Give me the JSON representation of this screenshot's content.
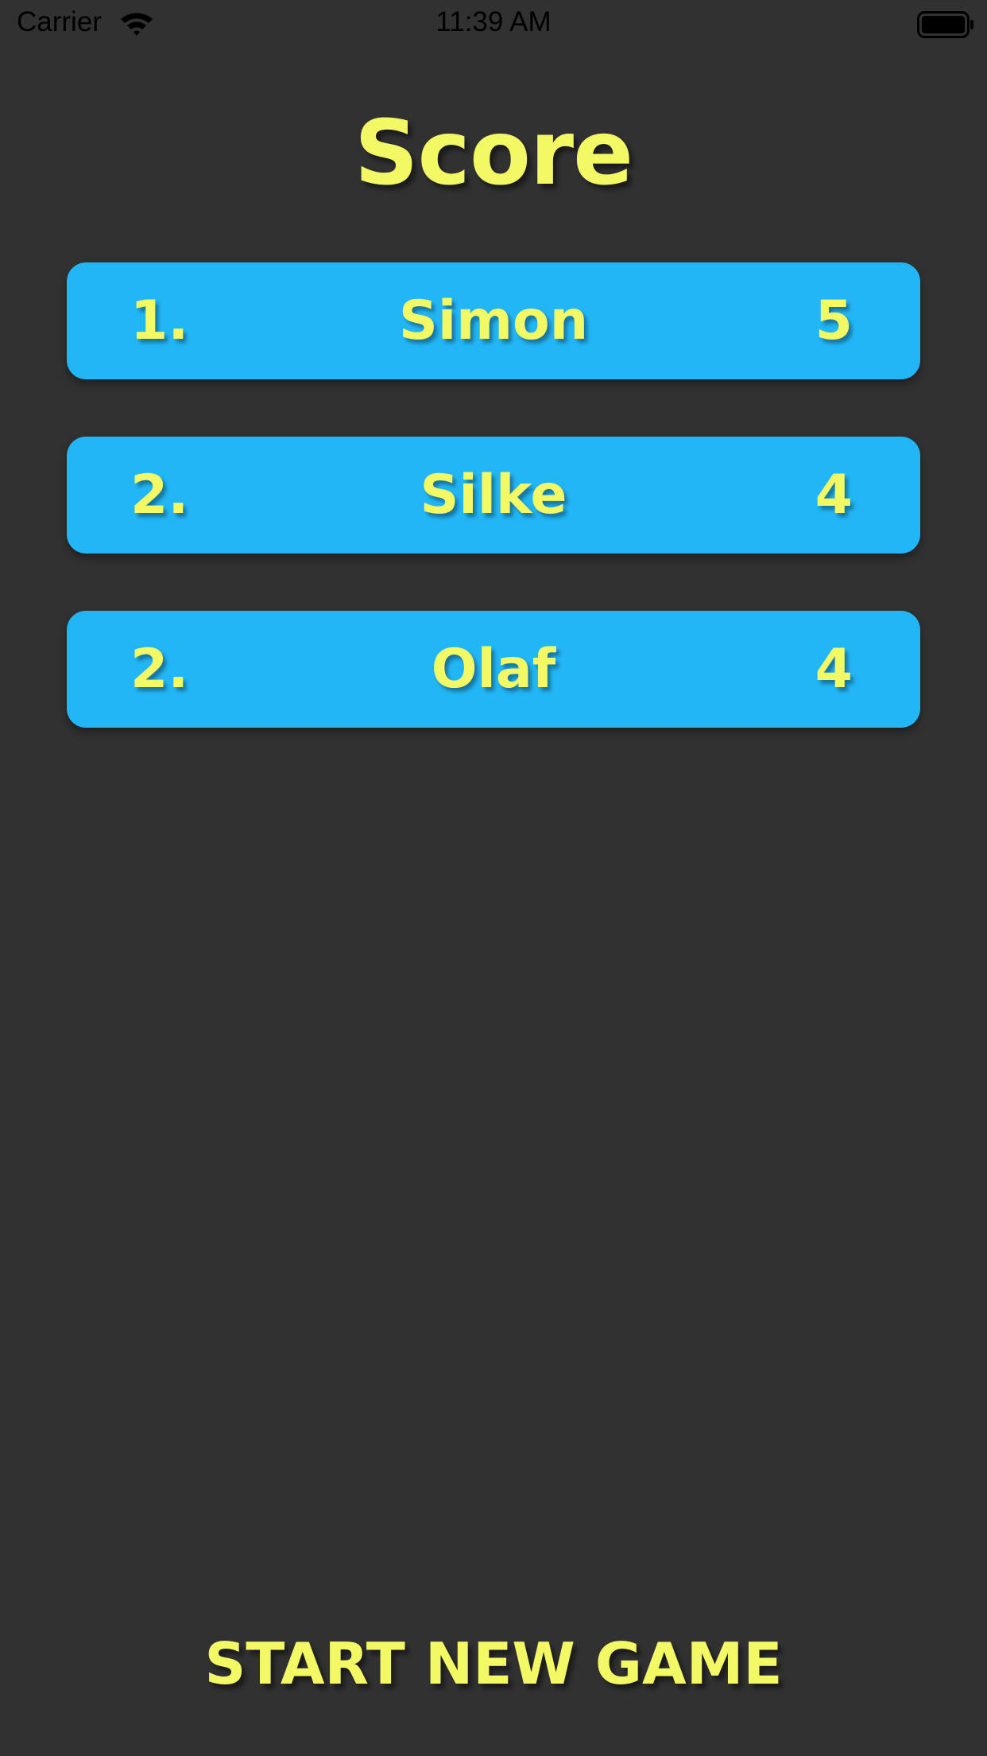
{
  "status_bar": {
    "carrier": "Carrier",
    "time": "11:39 AM",
    "icons": [
      "wifi-icon",
      "battery-icon"
    ]
  },
  "title": "Score",
  "scores": [
    {
      "rank": "1.",
      "name": "Simon",
      "points": "5"
    },
    {
      "rank": "2.",
      "name": "Silke",
      "points": "4"
    },
    {
      "rank": "2.",
      "name": "Olaf",
      "points": "4"
    }
  ],
  "start_button_label": "START NEW GAME",
  "colors": {
    "background": "#313131",
    "row": "#22b6f6",
    "text": "#f2f965"
  }
}
